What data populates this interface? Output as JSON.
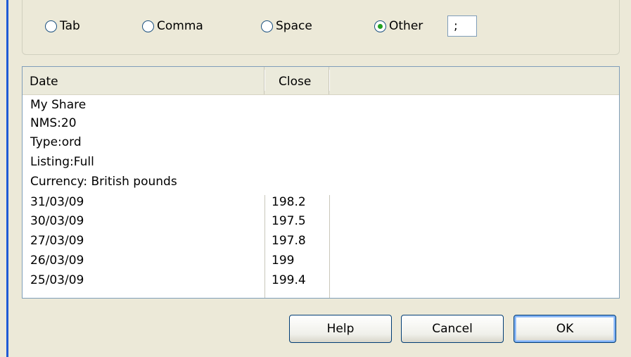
{
  "delimiters": {
    "options": [
      {
        "label": "Tab",
        "checked": false
      },
      {
        "label": "Comma",
        "checked": false
      },
      {
        "label": "Space",
        "checked": false
      },
      {
        "label": "Other",
        "checked": true
      }
    ],
    "other_value": ";"
  },
  "table": {
    "columns": [
      "Date",
      "Close"
    ],
    "info_rows": [
      "My Share",
      "NMS:20",
      "Type:ord",
      "Listing:Full",
      "Currency: British pounds"
    ],
    "rows": [
      {
        "date": "31/03/09",
        "close": "198.2"
      },
      {
        "date": "30/03/09",
        "close": "197.5"
      },
      {
        "date": "27/03/09",
        "close": "197.8"
      },
      {
        "date": "26/03/09",
        "close": "199"
      },
      {
        "date": "25/03/09",
        "close": "199.4"
      }
    ]
  },
  "buttons": {
    "help": "Help",
    "cancel": "Cancel",
    "ok": "OK"
  },
  "colors": {
    "selected_radio_dot": "#21a121",
    "window_border": "#1f5bd6",
    "dialog_background": "#ece9d8"
  }
}
